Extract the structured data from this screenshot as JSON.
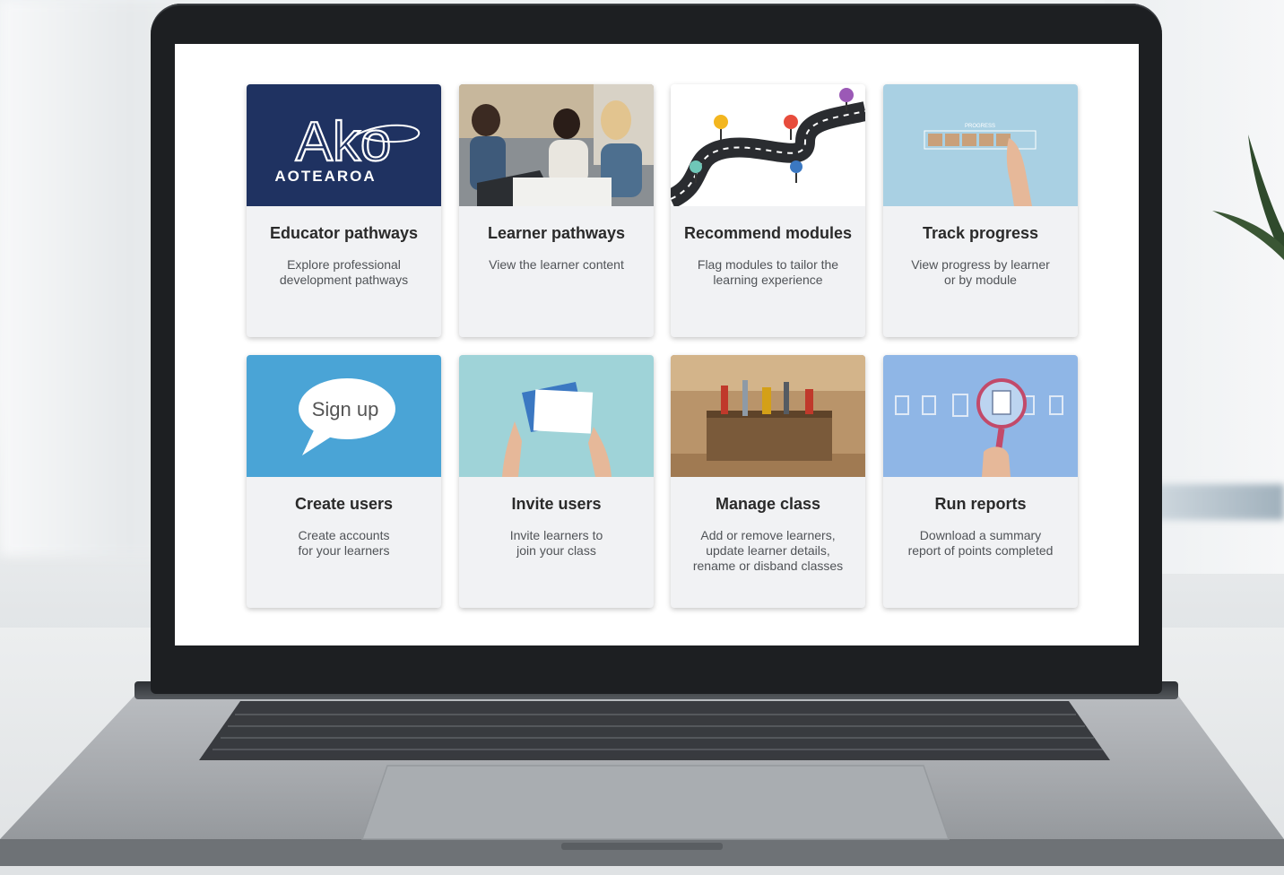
{
  "brand": {
    "logo_word": "Ako",
    "logo_sub": "AOTEAROA",
    "navy": "#1f3261"
  },
  "cards": [
    {
      "title": "Educator pathways",
      "desc": [
        "Explore professional",
        "development pathways"
      ],
      "image": "ako-aotearoa-logo"
    },
    {
      "title": "Learner pathways",
      "desc": [
        "View the learner content"
      ],
      "image": "students-studying-photo"
    },
    {
      "title": "Recommend modules",
      "desc": [
        "Flag modules to tailor the",
        "learning experience"
      ],
      "image": "winding-road-pins-illustration"
    },
    {
      "title": "Track progress",
      "desc": [
        "View progress by learner",
        "or by module"
      ],
      "image": "progress-blocks-photo",
      "image_text": "PROGRESS"
    },
    {
      "title": "Create users",
      "desc": [
        "Create accounts",
        "for your learners"
      ],
      "image": "sign-up-speech-bubble",
      "image_text": "Sign up"
    },
    {
      "title": "Invite users",
      "desc": [
        "Invite learners to",
        "join your class"
      ],
      "image": "invitation-cards-photo"
    },
    {
      "title": "Manage class",
      "desc": [
        "Add or remove learners,",
        "update learner details,",
        "rename or disband classes"
      ],
      "image": "toolbox-photo"
    },
    {
      "title": "Run reports",
      "desc": [
        "Download a summary",
        "report of points completed"
      ],
      "image": "magnifier-documents-photo"
    }
  ],
  "colors": {
    "card_bg": "#f1f2f4",
    "title": "#2a2a2a",
    "desc": "#505357",
    "bezel": "#1d1f22"
  }
}
